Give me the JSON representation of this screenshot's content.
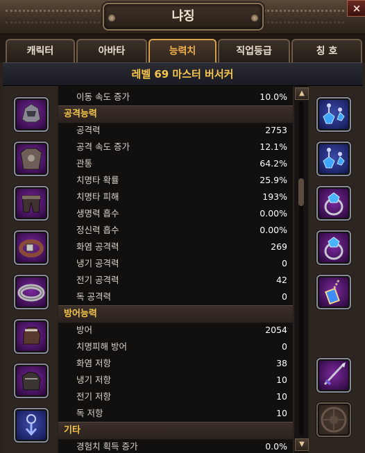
{
  "window": {
    "title": "냐징",
    "close_label": "×"
  },
  "tabs": [
    {
      "label": "캐릭터"
    },
    {
      "label": "아바타"
    },
    {
      "label": "능력치",
      "active": true
    },
    {
      "label": "직업등급"
    },
    {
      "label": "칭 호"
    }
  ],
  "class_banner": "레벨 69 마스터 버서커",
  "stats": {
    "top_row": {
      "label": "이동 속도 증가",
      "value": "10.0%"
    },
    "attack": {
      "header": "공격능력",
      "rows": [
        {
          "label": "공격력",
          "value": "2753"
        },
        {
          "label": "공격 속도 증가",
          "value": "12.1%"
        },
        {
          "label": "관통",
          "value": "64.2%"
        },
        {
          "label": "치명타 확률",
          "value": "25.9%"
        },
        {
          "label": "치명타 피해",
          "value": "193%"
        },
        {
          "label": "생명력 흡수",
          "value": "0.00%"
        },
        {
          "label": "정신력 흡수",
          "value": "0.00%"
        },
        {
          "label": "화염 공격력",
          "value": "269"
        },
        {
          "label": "냉기 공격력",
          "value": "0"
        },
        {
          "label": "전기 공격력",
          "value": "42"
        },
        {
          "label": "독 공격력",
          "value": "0"
        }
      ]
    },
    "defense": {
      "header": "방어능력",
      "rows": [
        {
          "label": "방어",
          "value": "2054"
        },
        {
          "label": "치명피해 방어",
          "value": "0"
        },
        {
          "label": "화염 저항",
          "value": "38"
        },
        {
          "label": "냉기 저항",
          "value": "10"
        },
        {
          "label": "전기 저항",
          "value": "10"
        },
        {
          "label": "독 저항",
          "value": "10"
        }
      ]
    },
    "etc": {
      "header": "기타",
      "rows": [
        {
          "label": "경험치 획득 증가",
          "value": "0.0%"
        }
      ]
    }
  },
  "scrollbar": {
    "up_icon": "▲",
    "down_icon": "▼",
    "position": 0.25
  },
  "equipment": {
    "left": [
      "helmet-icon",
      "chest-armor-icon",
      "pants-icon",
      "belt-icon",
      "bracer-icon",
      "gloves-icon",
      "boots-icon",
      "amulet-icon"
    ],
    "right": [
      "earring-icon",
      "earring-icon",
      "ring-icon",
      "ring-icon",
      "pendant-icon",
      "",
      "weapon-icon",
      "shield-icon"
    ]
  },
  "colors": {
    "header": "#f5c648",
    "banner": "#f6c64a",
    "active_tab": "#f2b24a"
  }
}
